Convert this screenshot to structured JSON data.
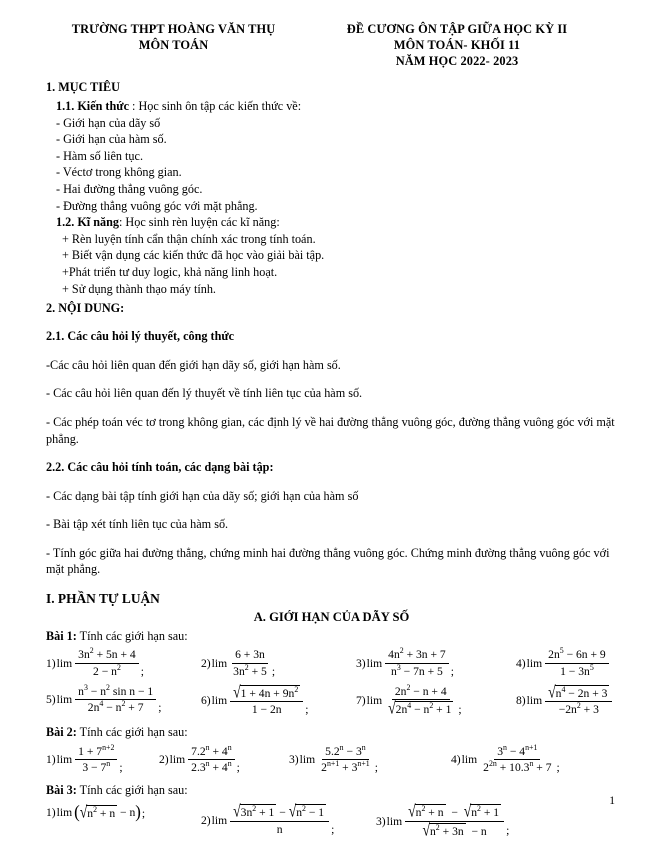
{
  "header": {
    "left_lines": [
      "TRƯỜNG THPT HOÀNG VĂN THỤ",
      "MÔN TOÁN"
    ],
    "right_lines": [
      "ĐỀ CƯƠNG ÔN TẬP GIỮA HỌC KỲ II",
      "MÔN TOÁN-  KHỐI 11",
      "NĂM HỌC 2022- 2023"
    ]
  },
  "sections": {
    "s1_title": "1. MỤC TIÊU",
    "s1_1_label": "1.1.  Kiến thức",
    "s1_1_rest": " : Học sinh ôn tập các kiến thức về:",
    "knowledge_items": [
      "- Giới hạn của dãy số",
      "- Giới hạn của hàm số.",
      "- Hàm số liên tục.",
      "- Véctơ trong không gian.",
      "- Hai đường thẳng vuông góc.",
      "- Đường thẳng vuông góc với mặt phẳng."
    ],
    "s1_2_label": "1.2. Kĩ năng",
    "s1_2_rest": ": Học sinh rèn luyện các kĩ năng:",
    "skill_items": [
      "+ Rèn luyện tính cẩn thận chính xác trong tính toán.",
      "+ Biết vận dụng các kiến thức đã học vào giải bài tập.",
      "+Phát triển tư duy logic, khả năng linh hoạt.",
      "+ Sử dụng thành thạo máy tính."
    ],
    "s2_title": "2. NỘI DUNG:",
    "s2_1_title": "2.1. Các câu hỏi lý thuyết, công thức",
    "s2_1_items": [
      "-Các câu hỏi liên quan đến giới hạn dãy số, giới hạn hàm số.",
      "- Các câu hỏi liên quan đến lý thuyết về tính liên tục của hàm số.",
      "- Các phép toán véc tơ trong không gian, các định lý về hai đường thẳng vuông góc, đường thẳng vuông góc với mặt phẳng."
    ],
    "s2_2_title": "2.2. Các câu hỏi tính toán, các dạng bài tập:",
    "s2_2_items": [
      "- Các dạng bài tập tính giới hạn của dãy số; giới hạn của hàm số",
      "- Bài tập xét tính liên tục của hàm số.",
      "- Tính góc giữa hai đường thẳng, chứng minh hai đường thẳng vuông góc. Chứng minh đường thẳng vuông góc với mặt phẳng."
    ],
    "part1_title": "I. PHẦN TỰ LUẬN",
    "sectionA_title": "A. GIỚI HẠN CỦA DÃY SỐ"
  },
  "exercises": {
    "bai1_label": "Bài 1:",
    "bai1_prompt": " Tính các giới hạn sau:",
    "bai2_label": "Bài 2:",
    "bai2_prompt": " Tính các giới hạn sau:",
    "bai3_label": "Bài 3:",
    "bai3_prompt": " Tính các giới hạn sau:",
    "lim": "lim",
    "semicolon": ";",
    "bai1": [
      {
        "n": "1)",
        "num": "3n² + 5n + 4",
        "den": "2 − n²",
        "end": ";"
      },
      {
        "n": "2)",
        "num": "6 + 3n",
        "den": "3n² + 5",
        "end": ";"
      },
      {
        "n": "3)",
        "num": "4n² + 3n + 7",
        "den": "n³ − 7n + 5",
        "end": ";"
      },
      {
        "n": "4)",
        "num": "2n⁵ − 6n + 9",
        "den": "1 − 3n⁵",
        "end": ""
      },
      {
        "n": "5)",
        "num": "n³ − n² sin n − 1",
        "den": "2n⁴ − n² + 7",
        "end": ";"
      },
      {
        "n": "6)",
        "num": "√(1 + 4n + 9n²)",
        "den": "1 − 2n",
        "end": ";"
      },
      {
        "n": "7)",
        "num": "2n² − n + 4",
        "den": "√(2n⁴ − n² + 1)",
        "end": ";"
      },
      {
        "n": "8)",
        "num": "√(n⁴ − 2n + 3)",
        "den": "−2n² + 3",
        "end": ""
      }
    ],
    "bai2": [
      {
        "n": "1)",
        "num": "1 + 7^(n+2)",
        "den": "3 − 7^n",
        "end": ";"
      },
      {
        "n": "2)",
        "num": "7.2^n + 4^n",
        "den": "2.3^n + 4^n",
        "end": ";"
      },
      {
        "n": "3)",
        "num": "5.2^n − 3^n",
        "den": "2^(n+1) + 3^(n+1)",
        "end": ";"
      },
      {
        "n": "4)",
        "num": "3^n − 4^(n+1)",
        "den": "2^(2n) + 10.3^n + 7",
        "end": ";"
      }
    ],
    "bai3": [
      {
        "n": "1)",
        "expr": "lim(√(n² + n) − n)",
        "end": ";"
      },
      {
        "n": "2)",
        "num": "√(3n² + 1) − √(n² − 1)",
        "den": "n",
        "end": ";"
      },
      {
        "n": "3)",
        "num": "√(n² + n) − √(n² + 1)",
        "den": "√(n² + 3n) − n",
        "end": ";"
      }
    ]
  },
  "footer": {
    "page_number": "1"
  }
}
